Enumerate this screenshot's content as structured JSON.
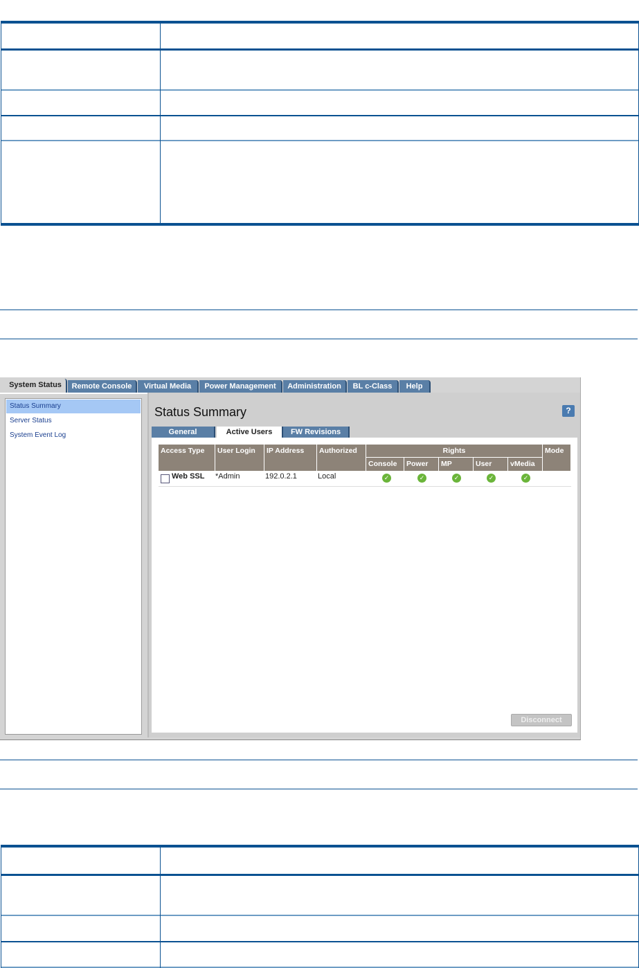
{
  "screenshot": {
    "top_tabs": [
      "System Status",
      "Remote Console",
      "Virtual Media",
      "Power Management",
      "Administration",
      "BL c-Class",
      "Help"
    ],
    "sidebar": [
      "Status Summary",
      "Server Status",
      "System Event Log"
    ],
    "title": "Status Summary",
    "help_icon": "?",
    "sub_tabs": [
      "General",
      "Active Users",
      "FW Revisions"
    ],
    "table": {
      "headers": [
        "Access Type",
        "User Login",
        "IP Address",
        "Authorized",
        "Rights",
        "Mode"
      ],
      "rights_headers": [
        "Console",
        "Power",
        "MP",
        "User",
        "vMedia"
      ],
      "rows": [
        {
          "access_type": "Web SSL",
          "user_login": "*Admin",
          "ip_address": "192.0.2.1",
          "authorized": "Local",
          "rights": [
            "check",
            "check",
            "check",
            "check",
            "check"
          ],
          "mode": ""
        }
      ]
    },
    "disconnect_label": "Disconnect"
  },
  "colors": {
    "rule": "#0a5191",
    "tab": "#5a7fa6",
    "header": "#8d8378",
    "check": "#6bb53a"
  }
}
